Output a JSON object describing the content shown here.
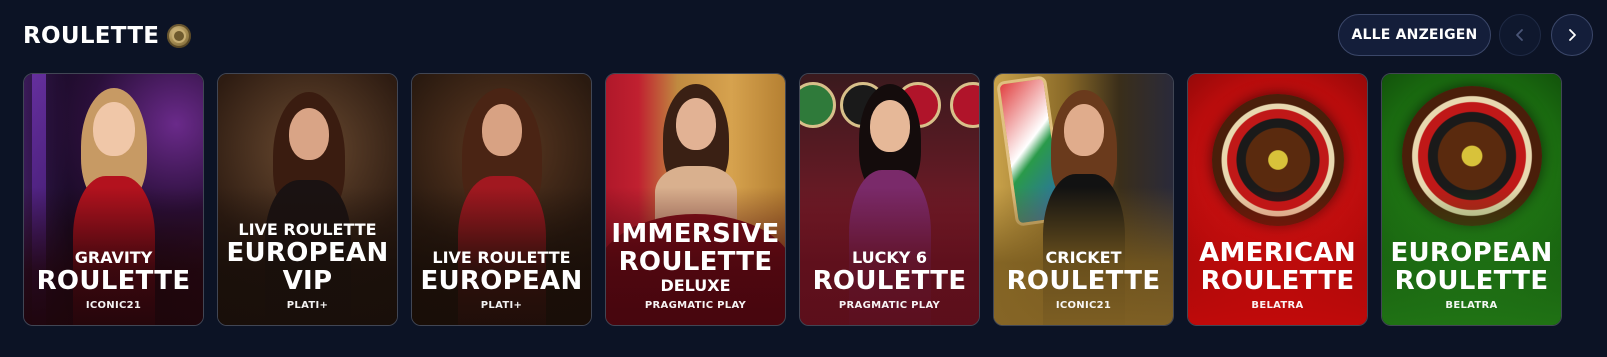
{
  "section": {
    "title": "ROULETTE",
    "title_icon": "roulette-chip-icon",
    "show_all_label": "ALLE ANZEIGEN",
    "prev_icon": "chevron-left-icon",
    "next_icon": "chevron-right-icon"
  },
  "colors": {
    "background": "#0c1325",
    "button_border": "#3b4769"
  },
  "games": [
    {
      "line1": "GRAVITY",
      "line2": "ROULETTE",
      "provider": "ICONIC21"
    },
    {
      "line1": "LIVE ROULETTE",
      "line2": "EUROPEAN",
      "line3": "VIP",
      "provider": "PLATI+"
    },
    {
      "line1": "LIVE ROULETTE",
      "line2": "EUROPEAN",
      "provider": "PLATI+"
    },
    {
      "line1": "IMMERSIVE",
      "line2": "ROULETTE",
      "line3": "DELUXE",
      "provider": "PRAGMATIC PLAY"
    },
    {
      "line1": "LUCKY 6",
      "line2": "ROULETTE",
      "provider": "PRAGMATIC PLAY"
    },
    {
      "line1": "CRICKET",
      "line2": "ROULETTE",
      "provider": "ICONIC21"
    },
    {
      "line1": "AMERICAN",
      "line2": "ROULETTE",
      "provider": "BELATRA"
    },
    {
      "line1": "EUROPEAN",
      "line2": "ROULETTE",
      "provider": "BELATRA"
    }
  ]
}
